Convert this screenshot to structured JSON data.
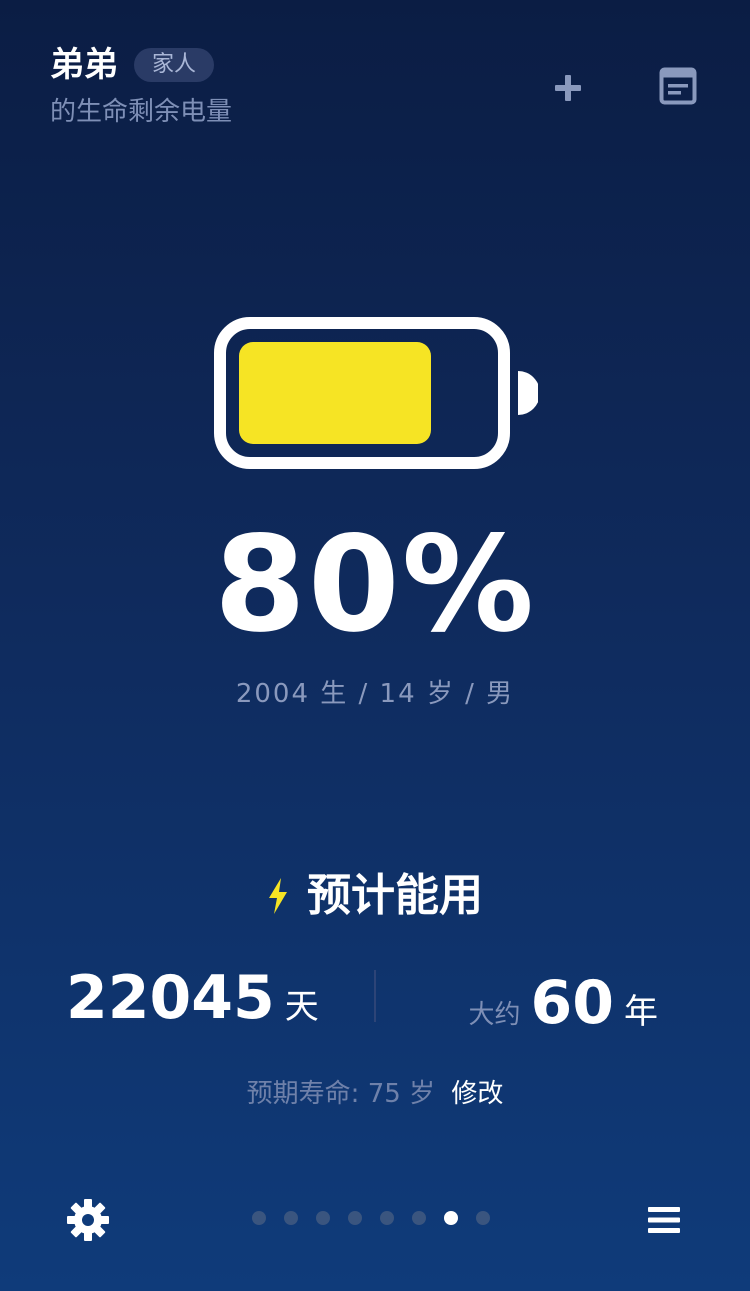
{
  "header": {
    "name": "弟弟",
    "relation_badge": "家人",
    "subtitle": "的生命剩余电量"
  },
  "battery": {
    "level_percent": 80,
    "fill_color": "#f6e424",
    "outline_color": "#ffffff"
  },
  "summary": {
    "percent_text": "80%",
    "birth_info": "2004 生 / 14 岁 / 男"
  },
  "estimate": {
    "title": "预计能用",
    "days_value": "22045",
    "days_unit": "天",
    "years_prefix": "大约",
    "years_value": "60",
    "years_unit": "年",
    "life_expectancy_text": "预期寿命: 75 岁",
    "edit_label": "修改"
  },
  "pager": {
    "count": 8,
    "active_index": 6
  },
  "colors": {
    "accent_yellow": "#f6e424",
    "background_top": "#0b1d44",
    "background_bottom": "#0f3b7a",
    "muted_text": "#7e8fb6"
  },
  "icons": {
    "add": "plus-icon",
    "note": "note-icon",
    "bolt": "lightning-icon",
    "settings": "gear-icon",
    "menu": "menu-icon"
  }
}
